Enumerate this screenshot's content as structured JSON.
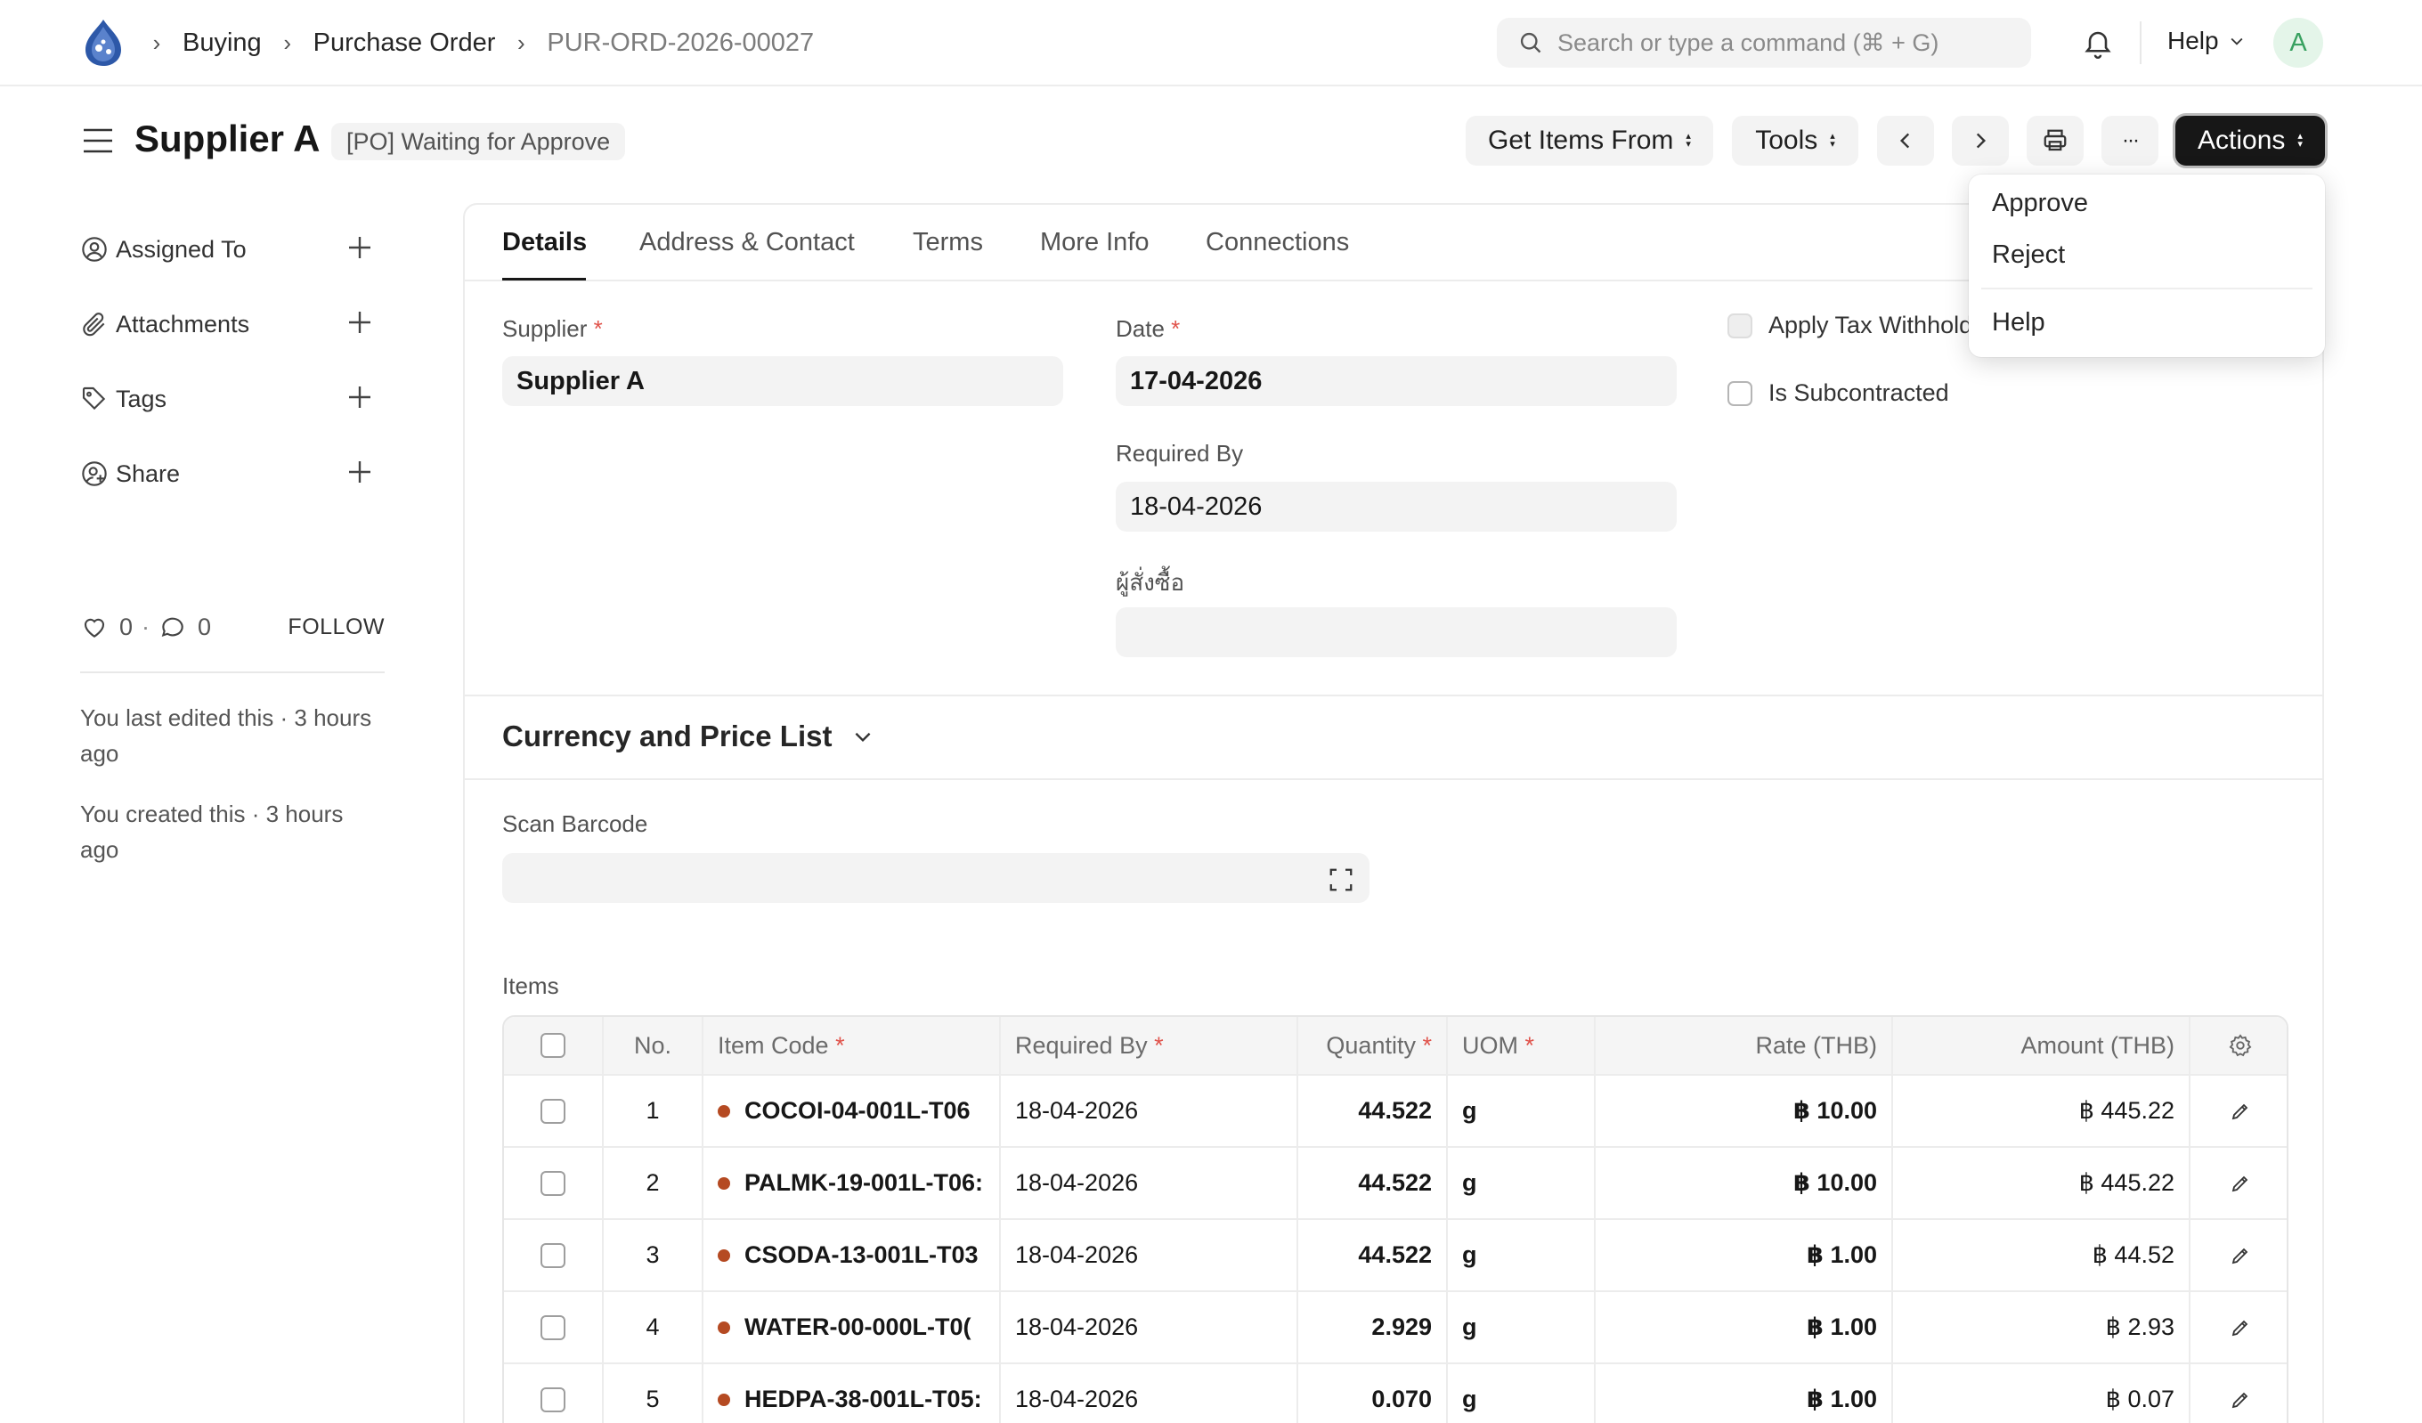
{
  "nav": {
    "breadcrumbs": [
      "Buying",
      "Purchase Order",
      "PUR-ORD-2026-00027"
    ],
    "search_placeholder": "Search or type a command (⌘ + G)",
    "help_label": "Help",
    "avatar_initial": "A"
  },
  "header": {
    "title": "Supplier A",
    "status": "[PO] Waiting for Approve",
    "get_items_label": "Get Items From",
    "tools_label": "Tools",
    "more_label": "···",
    "actions_label": "Actions"
  },
  "actions_menu": {
    "items": [
      "Approve",
      "Reject",
      "Help"
    ]
  },
  "sidebar": {
    "items": [
      "Assigned To",
      "Attachments",
      "Tags",
      "Share"
    ],
    "likes": "0",
    "comments": "0",
    "dot": "·",
    "follow_label": "FOLLOW",
    "last_edited": "You last edited this · 3 hours ago",
    "created": "You created this · 3 hours ago"
  },
  "tabs": [
    "Details",
    "Address & Contact",
    "Terms",
    "More Info",
    "Connections"
  ],
  "form": {
    "supplier_label": "Supplier",
    "supplier_value": "Supplier A",
    "date_label": "Date",
    "date_value": "17-04-2026",
    "required_by_label": "Required By",
    "required_by_value": "18-04-2026",
    "orderer_label": "ผู้สั่งซื้อ",
    "orderer_value": "",
    "apply_tax_label": "Apply Tax Withholding Amount",
    "is_subcontracted_label": "Is Subcontracted",
    "required_mark": "*"
  },
  "currency_section": {
    "title": "Currency and Price List"
  },
  "barcode": {
    "label": "Scan Barcode",
    "value": ""
  },
  "items": {
    "label": "Items",
    "columns": [
      "No.",
      "Item Code",
      "Required By",
      "Quantity",
      "UOM",
      "Rate (THB)",
      "Amount (THB)"
    ],
    "rows": [
      {
        "no": "1",
        "item_code": "COCOI-04-001L-T06",
        "required_by": "18-04-2026",
        "qty": "44.522",
        "uom": "g",
        "rate": "฿ 10.00",
        "amount": "฿ 445.22"
      },
      {
        "no": "2",
        "item_code": "PALMK-19-001L-T06:",
        "required_by": "18-04-2026",
        "qty": "44.522",
        "uom": "g",
        "rate": "฿ 10.00",
        "amount": "฿ 445.22"
      },
      {
        "no": "3",
        "item_code": "CSODA-13-001L-T03",
        "required_by": "18-04-2026",
        "qty": "44.522",
        "uom": "g",
        "rate": "฿ 1.00",
        "amount": "฿ 44.52"
      },
      {
        "no": "4",
        "item_code": "WATER-00-000L-T0(",
        "required_by": "18-04-2026",
        "qty": "2.929",
        "uom": "g",
        "rate": "฿ 1.00",
        "amount": "฿ 2.93"
      },
      {
        "no": "5",
        "item_code": "HEDPA-38-001L-T05:",
        "required_by": "18-04-2026",
        "qty": "0.070",
        "uom": "g",
        "rate": "฿ 1.00",
        "amount": "฿ 0.07"
      }
    ]
  },
  "colors": {
    "required": "#e0524a",
    "item_dot": "#b54a22",
    "primary_button": "#171717",
    "avatar_bg": "#e4f5e9",
    "avatar_text": "#38a160"
  }
}
